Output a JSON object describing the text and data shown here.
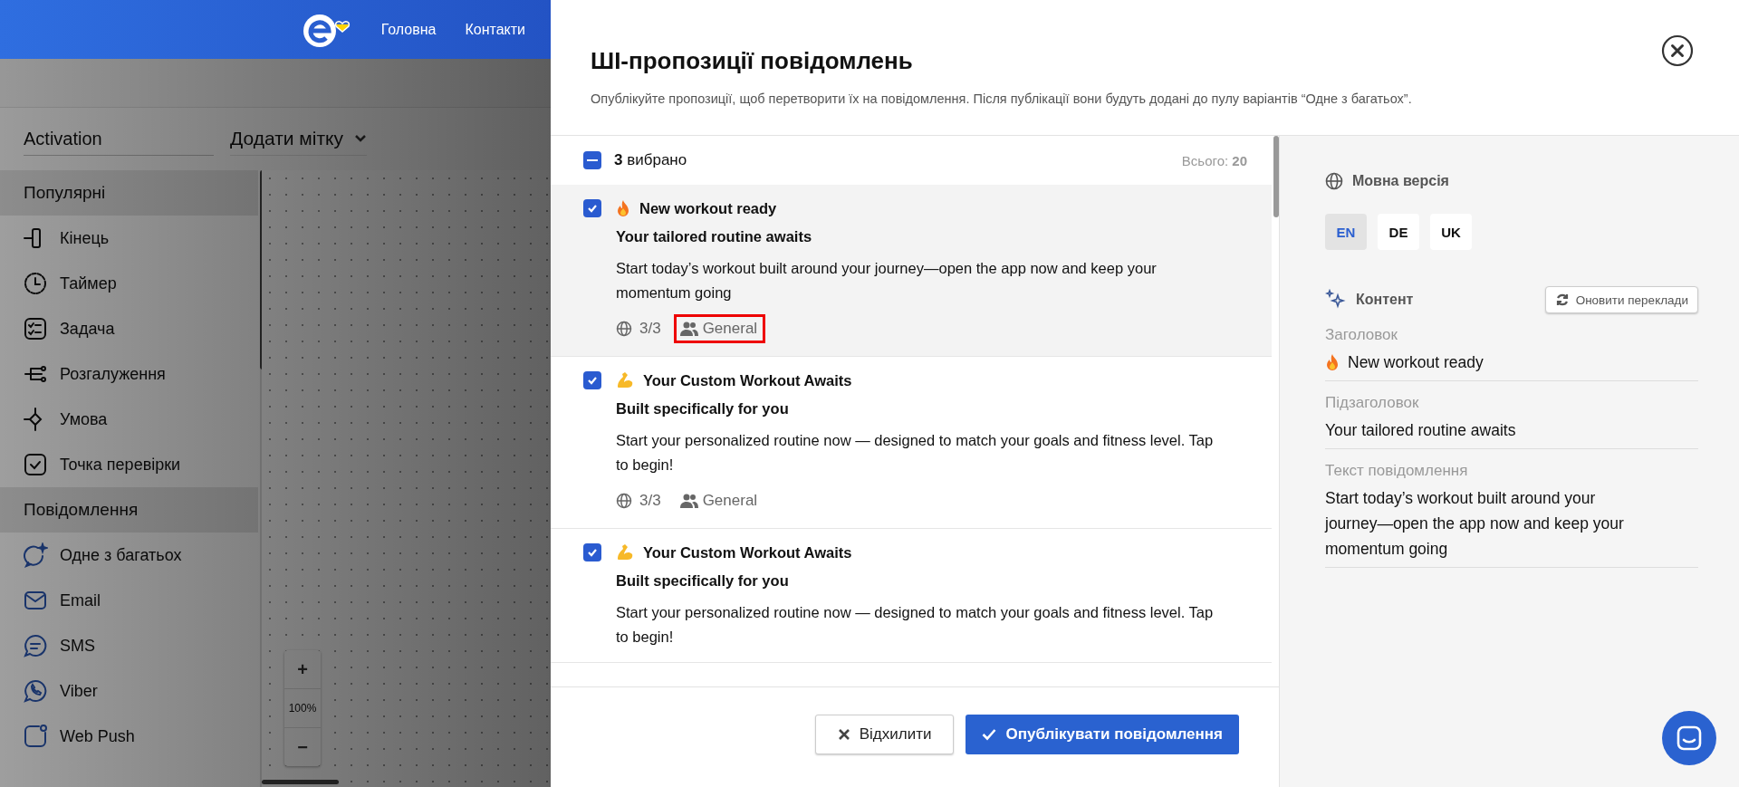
{
  "header": {
    "nav": [
      {
        "label": "Головна"
      },
      {
        "label": "Контакти"
      }
    ]
  },
  "toolbar": {
    "name_field": "Activation",
    "tag_dropdown": "Додати мітку"
  },
  "sidebar": {
    "sections": [
      {
        "title": "Популярні",
        "items": [
          {
            "label": "Кінець",
            "kind": "end"
          },
          {
            "label": "Таймер",
            "kind": "timer"
          },
          {
            "label": "Задача",
            "kind": "task"
          },
          {
            "label": "Розгалуження",
            "kind": "branch"
          },
          {
            "label": "Умова",
            "kind": "condition"
          },
          {
            "label": "Точка перевірки",
            "kind": "checkpoint"
          }
        ]
      },
      {
        "title": "Повідомлення",
        "items": [
          {
            "label": "Одне з багатьох",
            "kind": "ai-chat"
          },
          {
            "label": "Email",
            "kind": "email"
          },
          {
            "label": "SMS",
            "kind": "sms"
          },
          {
            "label": "Viber",
            "kind": "viber"
          },
          {
            "label": "Web Push",
            "kind": "push"
          }
        ]
      }
    ]
  },
  "zoom": {
    "in": "+",
    "level": "100%",
    "out": "−"
  },
  "modal": {
    "title": "ШІ-пропозиції повідомлень",
    "subtitle": "Опублікуйте пропозиції, щоб перетворити їх на повідомлення. Після публікації вони будуть додані до пулу варіантів “Одне з багатьох”.",
    "selection": {
      "indeterminate": true,
      "label": "**3** вибрано",
      "total": "Всього: **20**"
    },
    "suggestions": [
      {
        "selected": true,
        "checked": true,
        "kind": "flame",
        "title": "New workout ready",
        "subtitle": "Your tailored routine awaits",
        "body": "Start today’s workout built around your journey—open the app now and keep your momentum going",
        "locales": "3/3",
        "segment": "General",
        "highlighted": true
      },
      {
        "selected": false,
        "checked": true,
        "kind": "muscle",
        "title": "Your Custom Workout Awaits",
        "subtitle": "Built specifically for you",
        "body": "Start your personalized routine now — designed to match your goals and fitness level. Tap to begin!",
        "locales": "3/3",
        "segment": "General",
        "highlighted": false
      },
      {
        "selected": false,
        "checked": true,
        "kind": "muscle",
        "title": "Your Custom Workout Awaits",
        "subtitle": "Built specifically for you",
        "body": "Start your personalized routine now — designed to match your goals and fitness level. Tap to begin!"
      }
    ],
    "reject_button": "Відхилити",
    "publish_button": "Опублікувати повідомлення"
  },
  "language": {
    "title": "Мовна версія",
    "options": [
      {
        "label": "EN",
        "selected": true
      },
      {
        "label": "DE",
        "selected": false
      },
      {
        "label": "UK",
        "selected": false
      }
    ]
  },
  "content": {
    "title": "Контент",
    "refresh_button": "Оновити переклади",
    "fields": [
      {
        "label": "Заголовок",
        "kind": "flame",
        "value": "New workout ready"
      },
      {
        "label": "Підзаголовок",
        "value": "Your tailored routine awaits"
      },
      {
        "label": "Текст повідомлення",
        "value": "Start today’s workout built around your journey—open the app now and keep your momentum going"
      }
    ]
  }
}
